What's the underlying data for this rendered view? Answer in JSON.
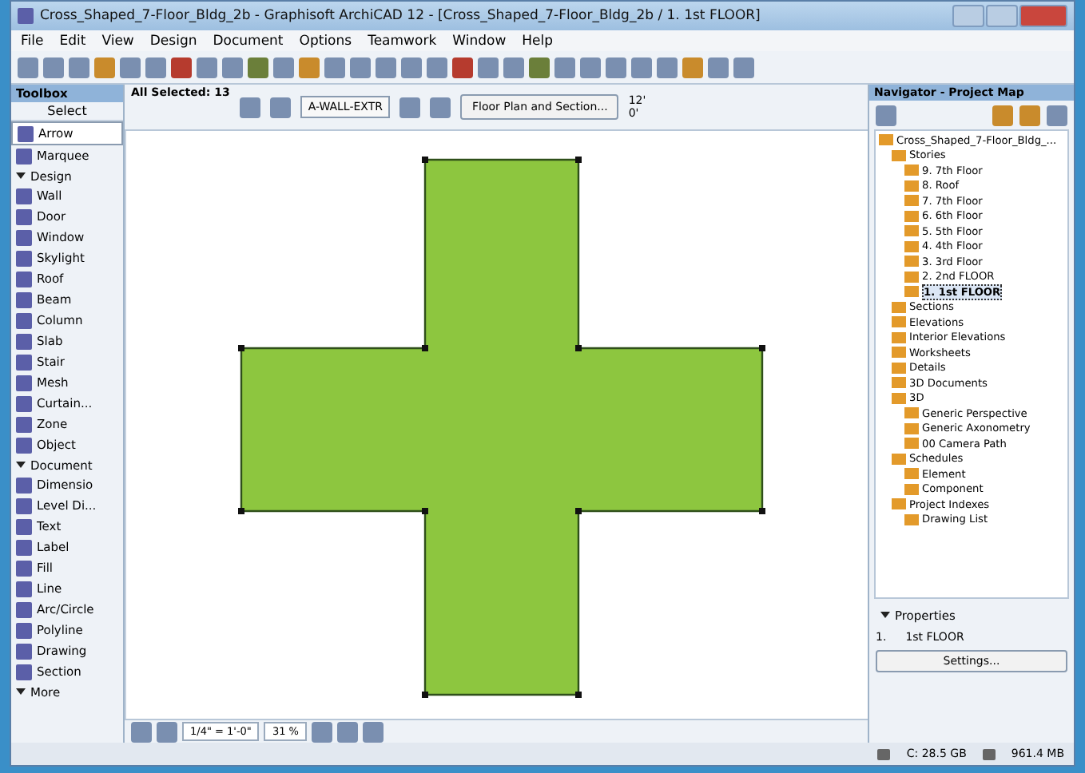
{
  "window": {
    "title": "Cross_Shaped_7-Floor_Bldg_2b - Graphisoft ArchiCAD 12 - [Cross_Shaped_7-Floor_Bldg_2b / 1. 1st FLOOR]"
  },
  "menu": [
    "File",
    "Edit",
    "View",
    "Design",
    "Document",
    "Options",
    "Teamwork",
    "Window",
    "Help"
  ],
  "toolbox": {
    "title": "Toolbox",
    "select_label": "Select",
    "items": [
      {
        "kind": "tool",
        "label": "Arrow",
        "selected": true
      },
      {
        "kind": "tool",
        "label": "Marquee",
        "selected": false
      },
      {
        "kind": "header",
        "label": "Design"
      },
      {
        "kind": "tool",
        "label": "Wall",
        "selected": false
      },
      {
        "kind": "tool",
        "label": "Door",
        "selected": false
      },
      {
        "kind": "tool",
        "label": "Window",
        "selected": false
      },
      {
        "kind": "tool",
        "label": "Skylight",
        "selected": false
      },
      {
        "kind": "tool",
        "label": "Roof",
        "selected": false
      },
      {
        "kind": "tool",
        "label": "Beam",
        "selected": false
      },
      {
        "kind": "tool",
        "label": "Column",
        "selected": false
      },
      {
        "kind": "tool",
        "label": "Slab",
        "selected": false
      },
      {
        "kind": "tool",
        "label": "Stair",
        "selected": false
      },
      {
        "kind": "tool",
        "label": "Mesh",
        "selected": false
      },
      {
        "kind": "tool",
        "label": "Curtain...",
        "selected": false
      },
      {
        "kind": "tool",
        "label": "Zone",
        "selected": false
      },
      {
        "kind": "tool",
        "label": "Object",
        "selected": false
      },
      {
        "kind": "header",
        "label": "Document"
      },
      {
        "kind": "tool",
        "label": "Dimensio",
        "selected": false
      },
      {
        "kind": "tool",
        "label": "Level Di...",
        "selected": false
      },
      {
        "kind": "tool",
        "label": "Text",
        "selected": false
      },
      {
        "kind": "tool",
        "label": "Label",
        "selected": false
      },
      {
        "kind": "tool",
        "label": "Fill",
        "selected": false
      },
      {
        "kind": "tool",
        "label": "Line",
        "selected": false
      },
      {
        "kind": "tool",
        "label": "Arc/Circle",
        "selected": false
      },
      {
        "kind": "tool",
        "label": "Polyline",
        "selected": false
      },
      {
        "kind": "tool",
        "label": "Drawing",
        "selected": false
      },
      {
        "kind": "tool",
        "label": "Section",
        "selected": false
      },
      {
        "kind": "header",
        "label": "More"
      }
    ]
  },
  "info_box": {
    "selection": "All Selected: 13",
    "layer": "A-WALL-EXTR",
    "floor_plan_button": "Floor Plan and Section...",
    "height_top": "12'",
    "height_bottom": "0'"
  },
  "canvas": {
    "scale": "1/4\" = 1'-0\"",
    "zoom": "31 %"
  },
  "navigator": {
    "title": "Navigator - Project Map",
    "tree": [
      {
        "label": "Cross_Shaped_7-Floor_Bldg_...",
        "selected": false,
        "children": [
          {
            "label": "Stories",
            "selected": false,
            "children": [
              {
                "label": "9. 7th Floor",
                "selected": false
              },
              {
                "label": "8. Roof",
                "selected": false
              },
              {
                "label": "7. 7th Floor",
                "selected": false
              },
              {
                "label": "6. 6th Floor",
                "selected": false
              },
              {
                "label": "5. 5th Floor",
                "selected": false
              },
              {
                "label": "4. 4th Floor",
                "selected": false
              },
              {
                "label": "3. 3rd Floor",
                "selected": false
              },
              {
                "label": "2. 2nd FLOOR",
                "selected": false
              },
              {
                "label": "1. 1st FLOOR",
                "selected": true
              }
            ]
          },
          {
            "label": "Sections",
            "selected": false
          },
          {
            "label": "Elevations",
            "selected": false
          },
          {
            "label": "Interior Elevations",
            "selected": false
          },
          {
            "label": "Worksheets",
            "selected": false
          },
          {
            "label": "Details",
            "selected": false
          },
          {
            "label": "3D Documents",
            "selected": false
          },
          {
            "label": "3D",
            "selected": false,
            "children": [
              {
                "label": "Generic Perspective",
                "selected": false
              },
              {
                "label": "Generic Axonometry",
                "selected": false
              },
              {
                "label": "00 Camera Path",
                "selected": false
              }
            ]
          },
          {
            "label": "Schedules",
            "selected": false,
            "children": [
              {
                "label": "Element",
                "selected": false
              },
              {
                "label": "Component",
                "selected": false
              }
            ]
          },
          {
            "label": "Project Indexes",
            "selected": false,
            "children": [
              {
                "label": "Drawing List",
                "selected": false
              }
            ]
          }
        ]
      }
    ],
    "properties": {
      "header": "Properties",
      "number": "1.",
      "name": "1st FLOOR",
      "settings_button": "Settings..."
    }
  },
  "status_bar": {
    "disk": "C: 28.5 GB",
    "memory": "961.4 MB"
  }
}
